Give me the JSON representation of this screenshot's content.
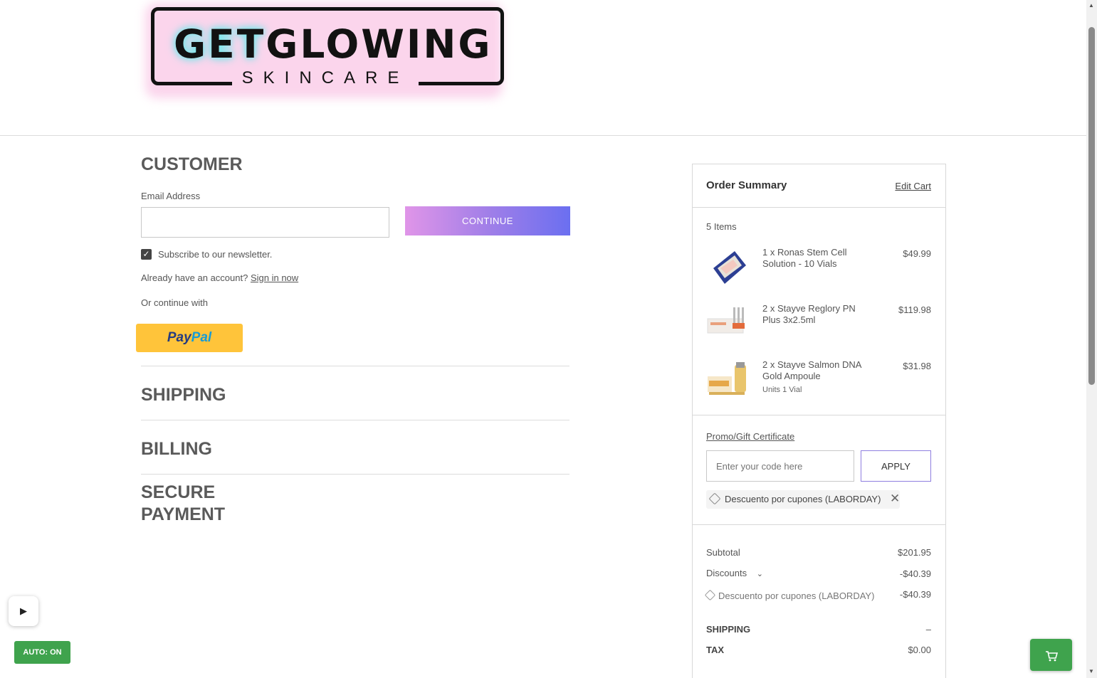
{
  "brand": {
    "logo_main_pre": "GET",
    "logo_main_post": "GLOWING",
    "logo_sub": "SKINCARE"
  },
  "customer": {
    "heading": "CUSTOMER",
    "email_label": "Email Address",
    "email_value": "",
    "continue_label": "CONTINUE",
    "newsletter_label": "Subscribe to our newsletter.",
    "newsletter_checked": true,
    "account_prompt": "Already have an account?",
    "sign_in_label": "Sign in now",
    "or_continue": "Or continue with",
    "paypal_part1": "Pay",
    "paypal_part2": "Pal"
  },
  "steps": {
    "shipping": "SHIPPING",
    "billing": "BILLING",
    "secure_payment_line1": "SECURE",
    "secure_payment_line2": "PAYMENT"
  },
  "summary": {
    "title": "Order Summary",
    "edit_cart": "Edit Cart",
    "items_count": "5 Items",
    "items": [
      {
        "name": "1 x Ronas Stem Cell Solution - 10 Vials",
        "price": "$49.99",
        "option": ""
      },
      {
        "name": "2 x Stayve Reglory PN Plus 3x2.5ml",
        "price": "$119.98",
        "option": ""
      },
      {
        "name": "2 x Stayve Salmon DNA Gold Ampoule",
        "price": "$31.98",
        "option": "Units 1 Vial"
      }
    ],
    "promo_link": "Promo/Gift Certificate",
    "promo_placeholder": "Enter your code here",
    "apply_label": "APPLY",
    "applied_coupon": "Descuento por cupones (LABORDAY)",
    "subtotal_label": "Subtotal",
    "subtotal_value": "$201.95",
    "discounts_label": "Discounts",
    "discounts_value": "-$40.39",
    "discount_detail_label": "Descuento por cupones (LABORDAY)",
    "discount_detail_value": "-$40.39",
    "shipping_label": "SHIPPING",
    "shipping_value": "–",
    "tax_label": "TAX",
    "tax_value": "$0.00"
  },
  "widgets": {
    "auto_label": "AUTO: ON"
  },
  "icons": {
    "play": "play-icon",
    "cart": "cart-icon",
    "close": "close-icon",
    "tag": "tag-icon",
    "chevron": "chevron-down-icon",
    "check": "checkmark-icon"
  },
  "colors": {
    "continue_gradient_start": "#e095e8",
    "continue_gradient_end": "#6b6ff0",
    "paypal_yellow": "#ffc43a",
    "widget_green": "#3fa34d"
  }
}
